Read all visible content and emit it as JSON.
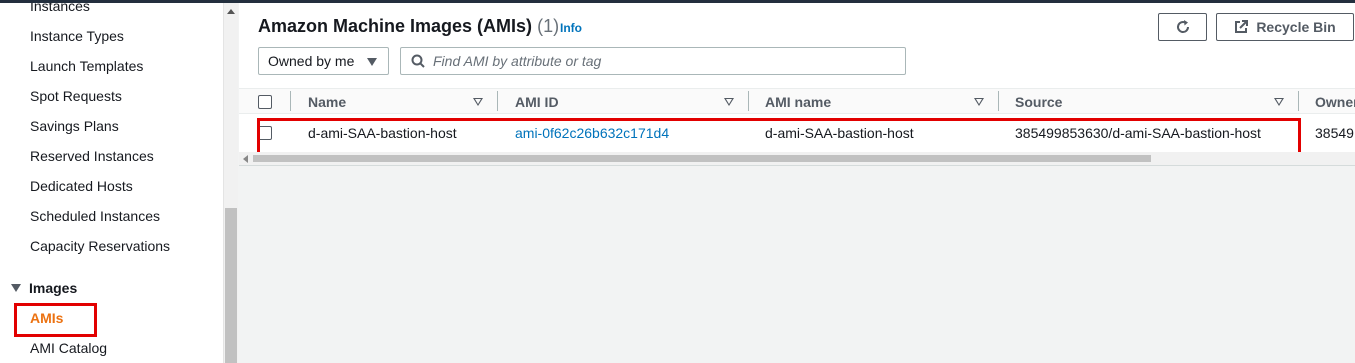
{
  "sidebar": {
    "items_top": [
      "Instances",
      "Instance Types",
      "Launch Templates",
      "Spot Requests",
      "Savings Plans",
      "Reserved Instances",
      "Dedicated Hosts",
      "Scheduled Instances",
      "Capacity Reservations"
    ],
    "section_images": "Images",
    "active_item": "AMIs",
    "item_catalog": "AMI Catalog"
  },
  "header": {
    "title": "Amazon Machine Images (AMIs)",
    "count": "(1)",
    "info_label": "Info",
    "recycle_bin_label": "Recycle Bin"
  },
  "filters": {
    "owner_select": "Owned by me",
    "search_placeholder": "Find AMI by attribute or tag"
  },
  "table": {
    "columns": [
      "Name",
      "AMI ID",
      "AMI name",
      "Source",
      "Owner"
    ],
    "rows": [
      {
        "name": "d-ami-SAA-bastion-host",
        "ami_id": "ami-0f62c26b632c171d4",
        "ami_name": "d-ami-SAA-bastion-host",
        "source": "385499853630/d-ami-SAA-bastion-host",
        "owner": "38549"
      }
    ]
  },
  "colors": {
    "link": "#0073bb",
    "active_nav": "#ec7211",
    "annotation_red": "#e20000"
  }
}
